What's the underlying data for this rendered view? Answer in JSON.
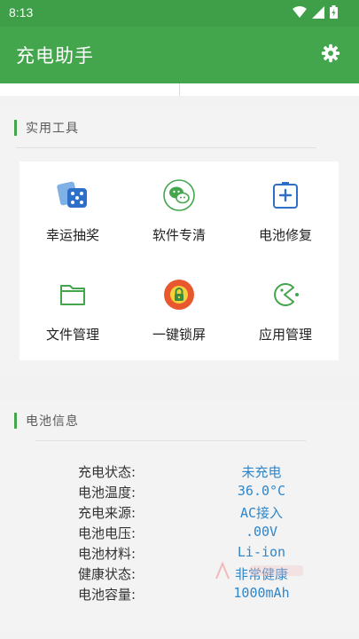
{
  "status_bar": {
    "time": "8:13",
    "icons": [
      "wifi-icon",
      "signal-icon",
      "battery-charging-icon"
    ]
  },
  "app_bar": {
    "title": "充电助手",
    "settings_icon": "gear-icon"
  },
  "tools_section": {
    "title": "实用工具",
    "items": [
      {
        "label": "幸运抽奖",
        "icon": "dice-icon"
      },
      {
        "label": "软件专清",
        "icon": "wechat-icon"
      },
      {
        "label": "电池修复",
        "icon": "battery-repair-icon"
      },
      {
        "label": "文件管理",
        "icon": "folder-icon"
      },
      {
        "label": "一键锁屏",
        "icon": "lock-icon"
      },
      {
        "label": "应用管理",
        "icon": "app-manager-icon"
      }
    ]
  },
  "battery_section": {
    "title": "电池信息",
    "rows": [
      {
        "key": "充电状态:",
        "value": "未充电"
      },
      {
        "key": "电池温度:",
        "value": "36.0°C"
      },
      {
        "key": "充电来源:",
        "value": "AC接入"
      },
      {
        "key": "电池电压:",
        "value": ".00V"
      },
      {
        "key": "电池材料:",
        "value": "Li-ion"
      },
      {
        "key": "健康状态:",
        "value": "非常健康"
      },
      {
        "key": "电池容量:",
        "value": "1000mAh"
      }
    ]
  },
  "colors": {
    "primary": "#43a64c",
    "value_text": "#2f86c9"
  }
}
